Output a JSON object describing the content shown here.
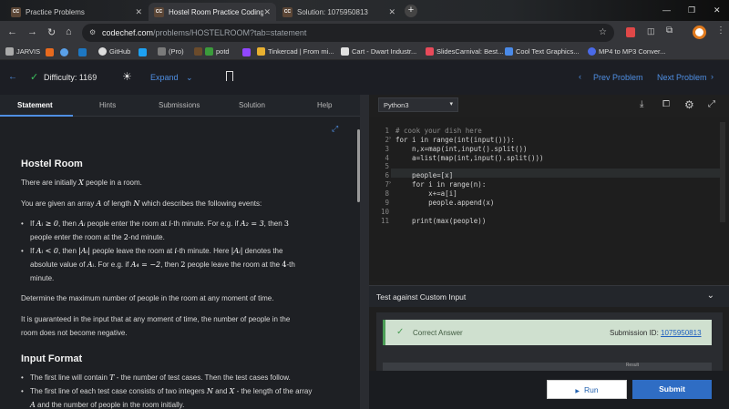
{
  "browser": {
    "tabs": [
      {
        "label": "Practice Problems",
        "favicon": "CC"
      },
      {
        "label": "Hostel Room Practice Coding Pr",
        "favicon": "CC"
      },
      {
        "label": "Solution: 1075950813",
        "favicon": "CC"
      }
    ],
    "new_tab": "+",
    "url_host": "codechef.com",
    "url_path": "/problems/HOSTELROOM?tab=statement",
    "bookmarks": [
      "JARVIS",
      "GitHub",
      "(Pro)",
      "potd",
      "Tinkercad | From mi...",
      "Cart - Dwart Industr...",
      "SlidesCarnival: Best...",
      "Cool Text Graphics...",
      "MP4 to MP3 Conver..."
    ]
  },
  "topbar": {
    "difficulty": "Difficulty: 1169",
    "expand": "Expand",
    "prev": "Prev Problem",
    "next": "Next Problem"
  },
  "left_tabs": [
    "Statement",
    "Hints",
    "Submissions",
    "Solution",
    "Help"
  ],
  "statement": {
    "title": "Hostel Room",
    "p1_a": "There are initially ",
    "p1_x": "X",
    "p1_b": " people in a room.",
    "p2_a": "You are given an array ",
    "p2_A": "A",
    "p2_b": " of length ",
    "p2_N": "N",
    "p2_c": " which describes the following events:",
    "b1_a": "If ",
    "b1_m1": "Aᵢ ≥ 0",
    "b1_b": ", then ",
    "b1_m2": "Aᵢ",
    "b1_c": " people enter the room at ",
    "b1_m3": "i",
    "b1_d": "-th minute. For e.g. if ",
    "b1_m4": "A₂ = 3",
    "b1_e": ", then ",
    "b1_m5": "3",
    "b1_f": "people enter the room at the ",
    "b1_m6": "2",
    "b1_g": "-nd minute.",
    "b2_a": "If ",
    "b2_m1": "Aᵢ < 0",
    "b2_b": ", then ",
    "b2_m2": "|Aᵢ|",
    "b2_c": " people leave the room at ",
    "b2_m3": "i",
    "b2_d": "-th minute. Here ",
    "b2_m4": "|Aᵢ|",
    "b2_e": " denotes the",
    "b2_f": "absolute value of ",
    "b2_m5": "Aᵢ",
    "b2_g": ". For e.g. if ",
    "b2_m6": "A₄ = −2",
    "b2_h": ", then ",
    "b2_m7": "2",
    "b2_i": " people leave the room at the ",
    "b2_m8": "4",
    "b2_j": "-th",
    "b2_k": "minute.",
    "p3": "Determine the maximum number of people in the room at any moment of time.",
    "p4_a": "It is guaranteed in the input that at any moment of time, the number of people in the",
    "p4_b": "room does not become negative.",
    "input_title": "Input Format",
    "i1_a": "The first line will contain ",
    "i1_m": "T",
    "i1_b": " - the number of test cases. Then the test cases follow.",
    "i2_a": "The first line of each test case consists of two integers ",
    "i2_m1": "N",
    "i2_b": " and ",
    "i2_m2": "X",
    "i2_c": " - the length of the array",
    "i2_m3": "A",
    "i2_d": " and the number of people in the room initially."
  },
  "editor": {
    "language": "Python3",
    "line_numbers": [
      "1",
      "2",
      "3",
      "4",
      "5",
      "6",
      "7",
      "8",
      "9",
      "10",
      "11"
    ],
    "lines": [
      "# cook your dish here",
      "for i in range(int(input())):",
      "    n,x=map(int,input().split())",
      "    a=list(map(int,input().split()))",
      "",
      "    people=[x]",
      "    for i in range(n):",
      "        x+=a[i]",
      "        people.append(x)",
      "",
      "    print(max(people))"
    ]
  },
  "custom_input": "Test against Custom Input",
  "result": {
    "status": "Correct Answer",
    "submission_label": "Submission ID: ",
    "submission_id": "1075950813",
    "result_header": "Result"
  },
  "buttons": {
    "run": "Run",
    "submit": "Submit"
  }
}
